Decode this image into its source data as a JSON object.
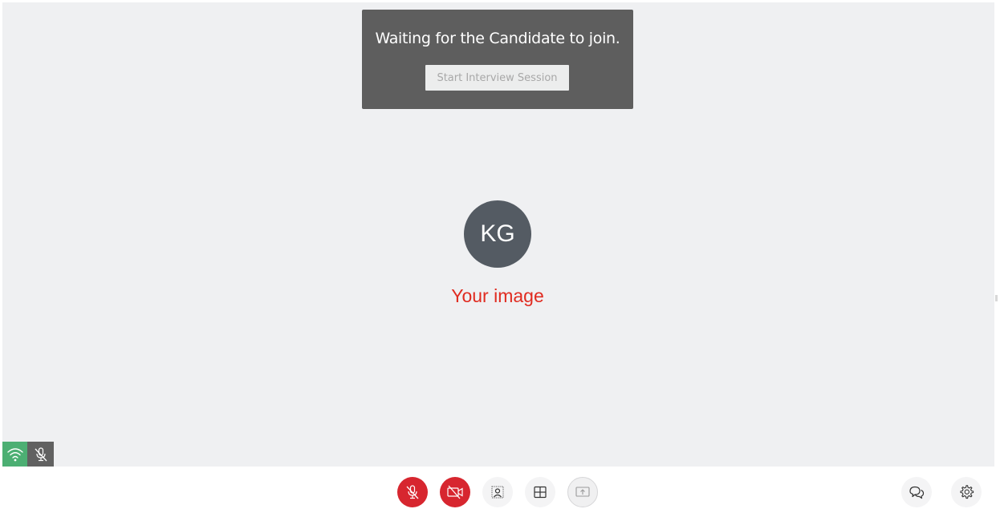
{
  "waiting_panel": {
    "message": "Waiting for the Candidate to join.",
    "start_button_label": "Start Interview Session"
  },
  "self_view": {
    "initials": "KG",
    "caption": "Your image"
  },
  "status": {
    "network": "wifi-icon",
    "microphone": "mic-muted-icon"
  },
  "toolbar": {
    "buttons": [
      {
        "name": "mute-microphone",
        "icon": "mic-off-icon",
        "state": "off"
      },
      {
        "name": "camera",
        "icon": "camera-off-icon",
        "state": "off"
      },
      {
        "name": "background",
        "icon": "background-blur-icon"
      },
      {
        "name": "layout",
        "icon": "grid-layout-icon"
      },
      {
        "name": "share-screen",
        "icon": "screen-share-icon"
      },
      {
        "name": "chat",
        "icon": "chat-icon"
      },
      {
        "name": "settings",
        "icon": "gear-icon"
      }
    ]
  },
  "colors": {
    "stage_background": "#eff0f2",
    "panel_background": "#5e5e5e",
    "avatar_background": "#545b63",
    "caption_red": "#e02b20",
    "danger_red": "#d7262f",
    "wifi_green": "#4caf73"
  }
}
